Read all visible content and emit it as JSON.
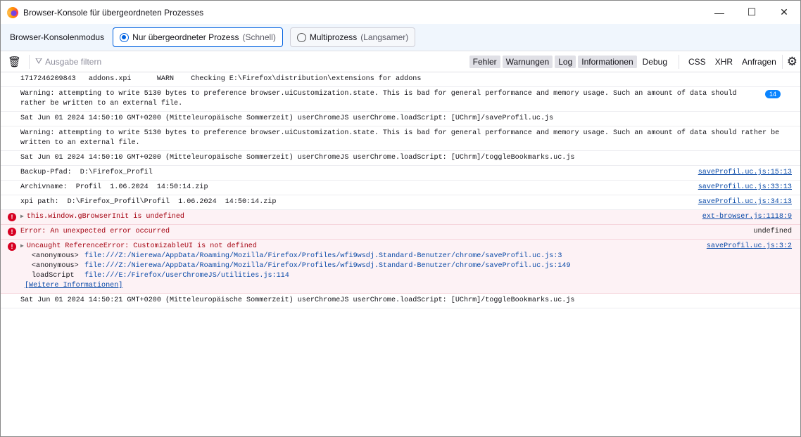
{
  "window": {
    "title": "Browser-Konsole für übergeordneten Prozesses",
    "minimize": "—",
    "maximize": "☐",
    "close": "✕"
  },
  "modebar": {
    "label": "Browser-Konsolenmodus",
    "options": [
      {
        "label": "Nur übergeordneter Prozess",
        "hint": "(Schnell)",
        "selected": true
      },
      {
        "label": "Multiprozess",
        "hint": "(Langsamer)",
        "selected": false
      }
    ]
  },
  "toolbar": {
    "filter_placeholder": "Ausgabe filtern",
    "filters": [
      {
        "label": "Fehler",
        "on": true
      },
      {
        "label": "Warnungen",
        "on": true
      },
      {
        "label": "Log",
        "on": true
      },
      {
        "label": "Informationen",
        "on": true
      },
      {
        "label": "Debug",
        "on": false
      }
    ],
    "extra": [
      "CSS",
      "XHR",
      "Anfragen"
    ]
  },
  "log": [
    {
      "msg": "1717246209843   addons.xpi      WARN    Checking E:\\Firefox\\distribution\\extensions for addons"
    },
    {
      "msg": "Warning: attempting to write 5130 bytes to preference browser.uiCustomization.state. This is bad for general performance and memory usage. Such an amount of data should rather be written to an external file.",
      "badge": "14"
    },
    {
      "msg": "Sat Jun 01 2024 14:50:10 GMT+0200 (Mitteleuropäische Sommerzeit) userChromeJS userChrome.loadScript: [UChrm]/saveProfil.uc.js"
    },
    {
      "msg": "Warning: attempting to write 5130 bytes to preference browser.uiCustomization.state. This is bad for general performance and memory usage. Such an amount of data should rather be written to an external file."
    },
    {
      "msg": "Sat Jun 01 2024 14:50:10 GMT+0200 (Mitteleuropäische Sommerzeit) userChromeJS userChrome.loadScript: [UChrm]/toggleBookmarks.uc.js"
    },
    {
      "msg": "Backup-Pfad:  D:\\Firefox_Profil",
      "src": "saveProfil.uc.js:15:13"
    },
    {
      "msg": "Archivname:  Profil  1.06.2024  14:50:14.zip",
      "src": "saveProfil.uc.js:33:13"
    },
    {
      "msg": "xpi path:  D:\\Firefox_Profil\\Profil  1.06.2024  14:50:14.zip",
      "src": "saveProfil.uc.js:34:13"
    }
  ],
  "errors": [
    {
      "msg": "this.window.gBrowserInit is undefined",
      "src": "ext-browser.js:1118:9",
      "twisty": true
    },
    {
      "msg": "Error: An unexpected error occurred",
      "src": "undefined",
      "twisty": false
    },
    {
      "msg": "Uncaught ReferenceError: CustomizableUI is not defined",
      "src": "saveProfil.uc.js:3:2",
      "twisty": true,
      "stack": [
        {
          "fn": "<anonymous>",
          "loc": "file:///Z:/Nierewa/AppData/Roaming/Mozilla/Firefox/Profiles/wfi9wsdj.Standard-Benutzer/chrome/saveProfil.uc.js:3"
        },
        {
          "fn": "<anonymous>",
          "loc": "file:///Z:/Nierewa/AppData/Roaming/Mozilla/Firefox/Profiles/wfi9wsdj.Standard-Benutzer/chrome/saveProfil.uc.js:149"
        },
        {
          "fn": "loadScript",
          "loc": "file:///E:/Firefox/userChromeJS/utilities.js:114"
        }
      ],
      "more": "[Weitere Informationen]"
    }
  ],
  "last": {
    "msg": "Sat Jun 01 2024 14:50:21 GMT+0200 (Mitteleuropäische Sommerzeit) userChromeJS userChrome.loadScript: [UChrm]/toggleBookmarks.uc.js"
  }
}
